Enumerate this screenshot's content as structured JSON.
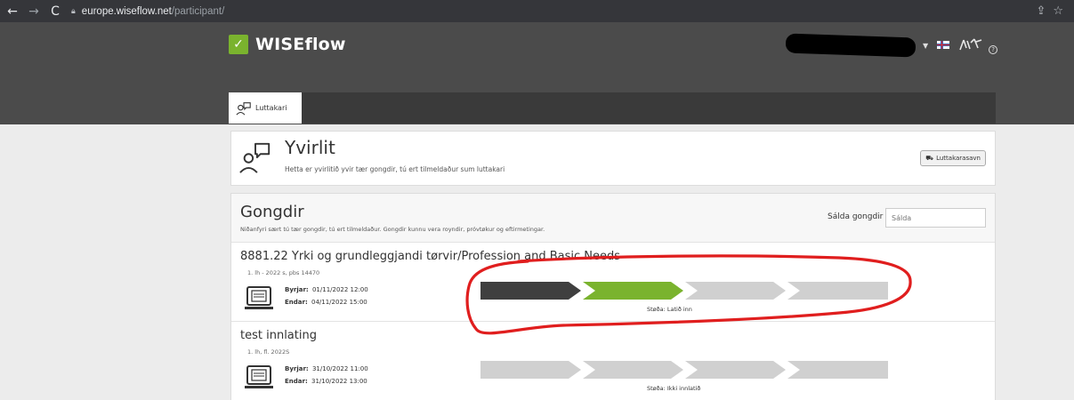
{
  "browser": {
    "url_domain": "europe.wiseflow.net",
    "url_path": "/participant/"
  },
  "header": {
    "logo_text": "WISEflow",
    "language_flag": "fo",
    "tab_label": "Luttakari"
  },
  "overview": {
    "title": "Yvirlit",
    "subtitle": "Hetta er yvirlitið yvir tær gongdir, tú ert tilmeldaður sum luttakari",
    "archive_button": "Luttakarasavn"
  },
  "courses_section": {
    "title": "Gongdir",
    "subtitle": "Niðanfyri sært tú tær gongdir, tú ert tilmeldaður. Gongdir kunnu vera royndir, próvtøkur og eftirmetingar.",
    "filter_label": "Sálda gongdir",
    "filter_placeholder": "Sálda",
    "courses": [
      {
        "title": "8881.22 Yrki og grundleggjandi tørvir/Profession and Basic Needs",
        "meta": "1. lh - 2022 s, pbs 14470",
        "start_label": "Byrjar:",
        "start": "01/11/2022 12:00",
        "end_label": "Endar:",
        "end": "04/11/2022 15:00",
        "status": "Støða: Latið inn",
        "progress_step_colors": [
          "#3f3f3f",
          "#7ab32e",
          "#d0d0d0",
          "#d0d0d0"
        ]
      },
      {
        "title": "test innlating",
        "meta": "1. lh, fl. 2022S",
        "start_label": "Byrjar:",
        "start": "31/10/2022 11:00",
        "end_label": "Endar:",
        "end": "31/10/2022 13:00",
        "status": "Støða: Ikki innlatið",
        "progress_step_colors": [
          "#d0d0d0",
          "#d0d0d0",
          "#d0d0d0",
          "#d0d0d0"
        ]
      }
    ]
  },
  "colors": {
    "brand_green": "#7ab32e",
    "annotation_red": "#e01e1e"
  }
}
